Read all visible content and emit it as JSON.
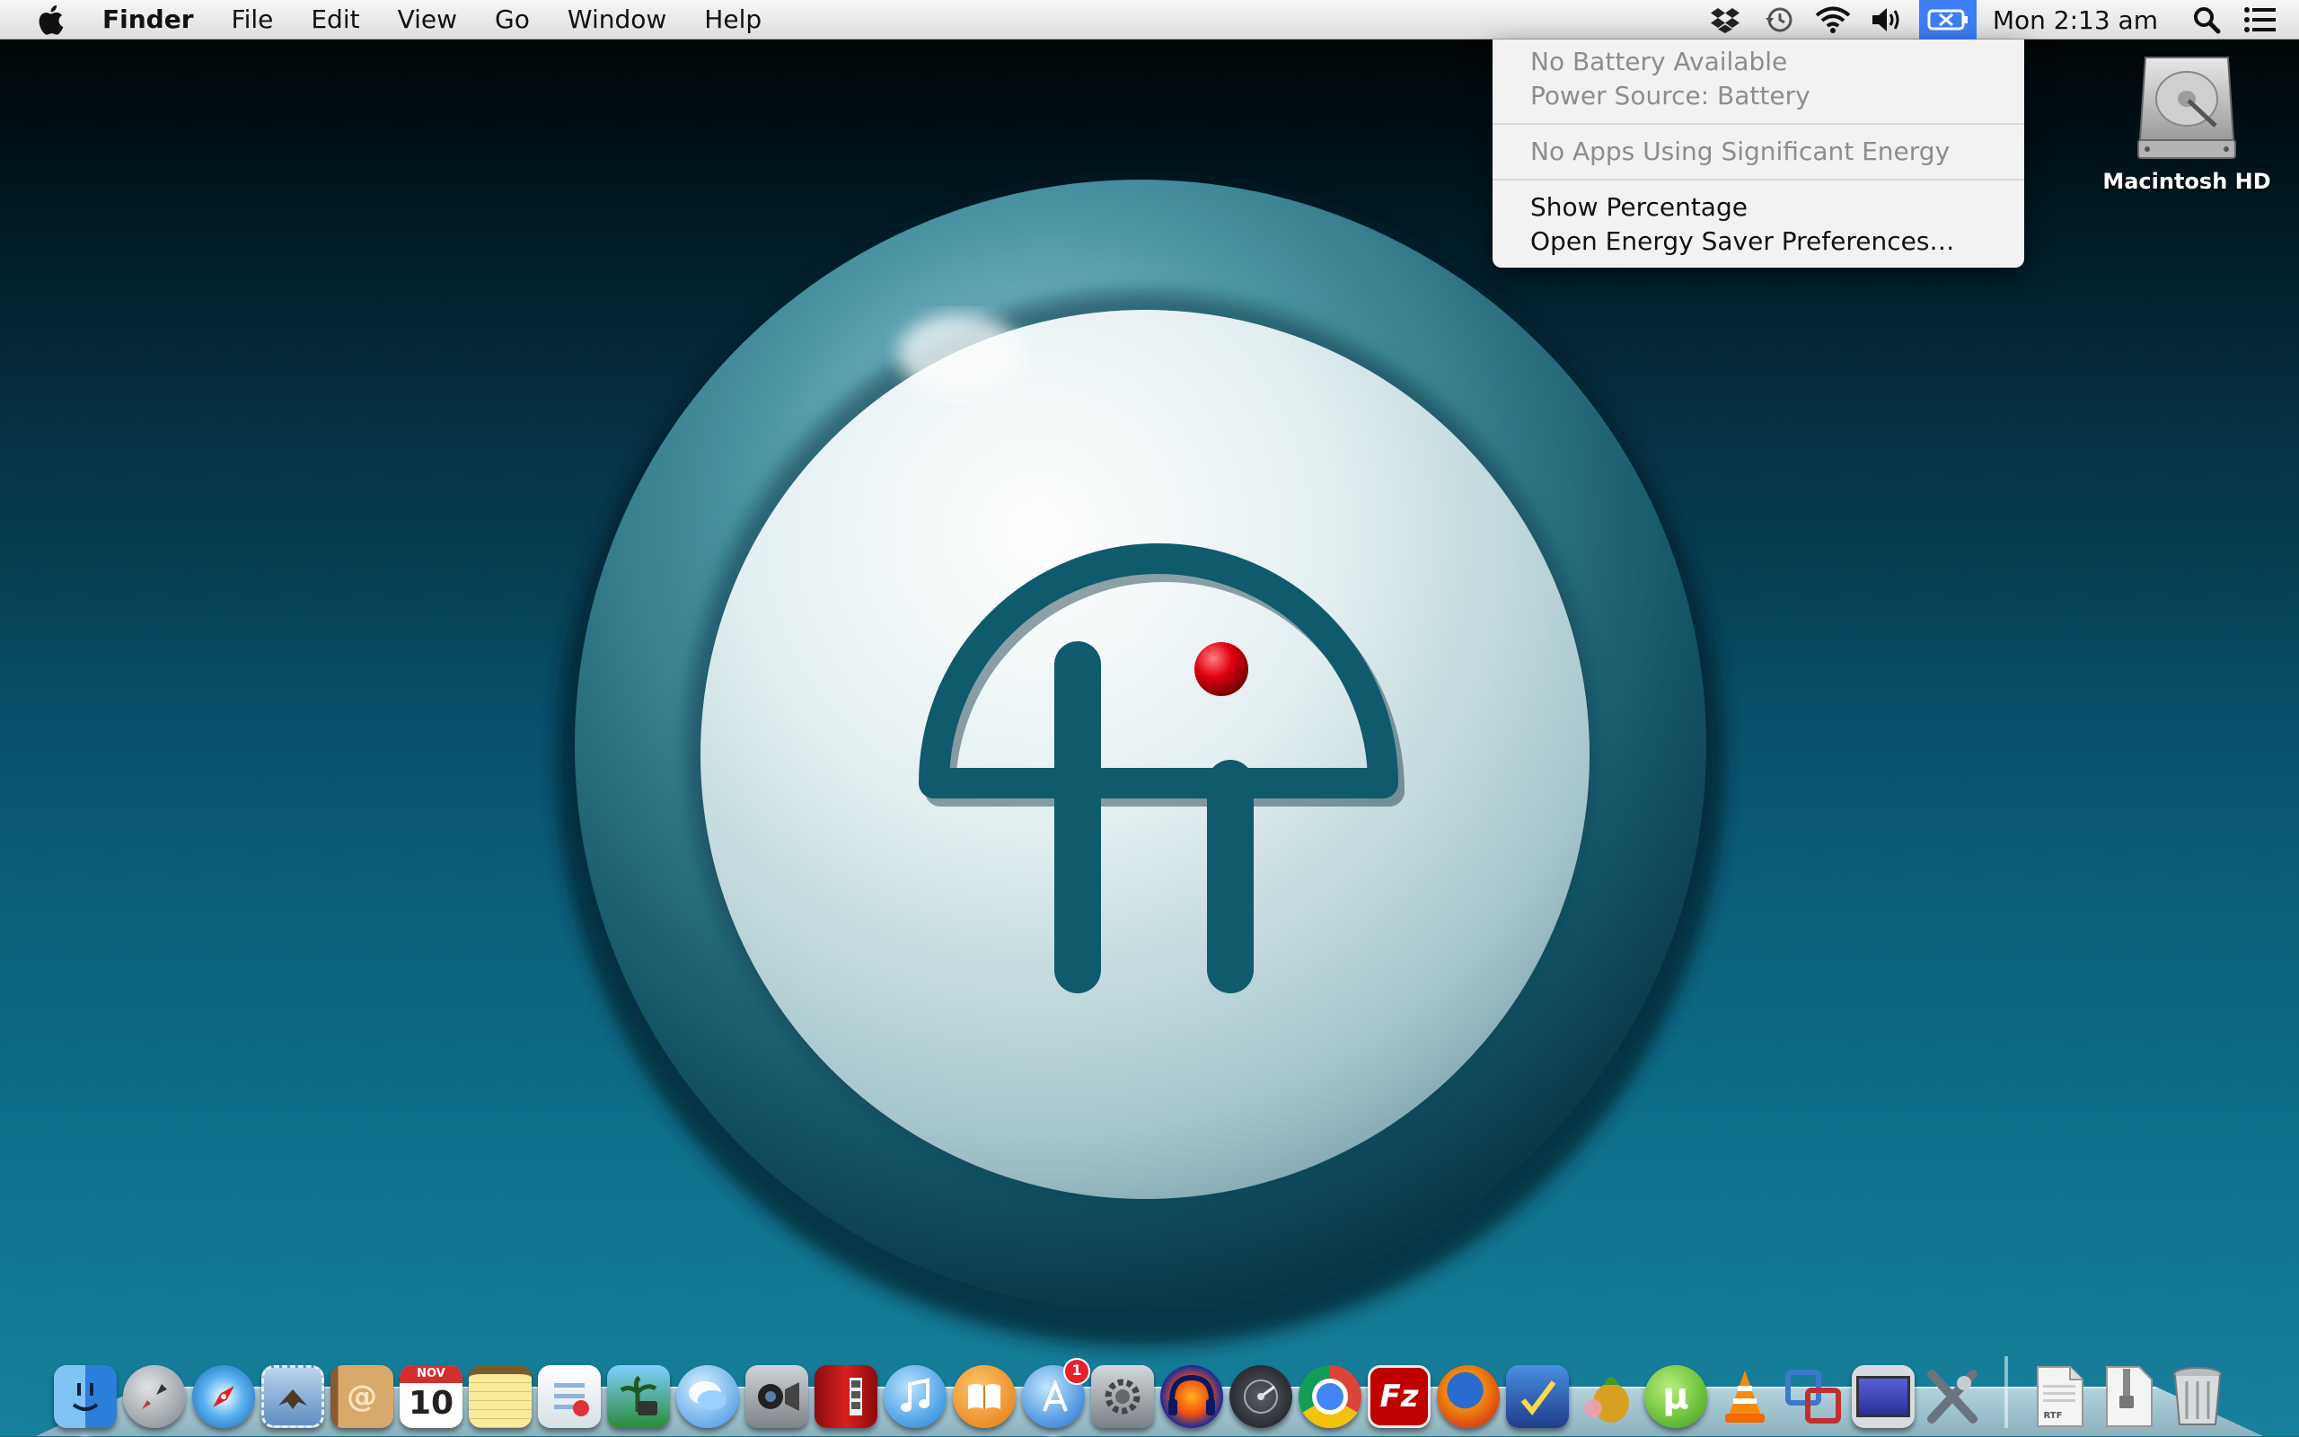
{
  "menubar": {
    "app_name": "Finder",
    "menus": [
      "File",
      "Edit",
      "View",
      "Go",
      "Window",
      "Help"
    ],
    "status_icons": [
      "dropbox-icon",
      "time-machine-icon",
      "wifi-icon",
      "volume-icon",
      "battery-icon"
    ],
    "clock": "Mon 2:13 am"
  },
  "battery_menu": {
    "status_line_1": "No Battery Available",
    "status_line_2": "Power Source: Battery",
    "energy_line": "No Apps Using Significant Energy",
    "show_percentage": "Show Percentage",
    "open_prefs": "Open Energy Saver Preferences…"
  },
  "desktop": {
    "drive_label": "Macintosh HD"
  },
  "dock": {
    "calendar_month": "NOV",
    "calendar_day": "10",
    "app_store_badge": "1",
    "filezilla_glyph": "Fz",
    "rtf_label": "RTF",
    "apps": [
      "finder",
      "launchpad",
      "safari",
      "mail",
      "contacts",
      "calendar",
      "notes",
      "reminders",
      "iphoto",
      "messages",
      "facetime",
      "photo-booth",
      "itunes",
      "ibooks",
      "app-store",
      "system-preferences",
      "audacity",
      "disk-utility",
      "chrome",
      "filezilla",
      "firefox",
      "fontforge",
      "adium",
      "utorrent",
      "vlc",
      "vmware",
      "display",
      "x11"
    ]
  },
  "colors": {
    "accent": "#3d7ff4",
    "wallpaper_teal": "#176c84",
    "logo_teal": "#0f5a6c"
  }
}
